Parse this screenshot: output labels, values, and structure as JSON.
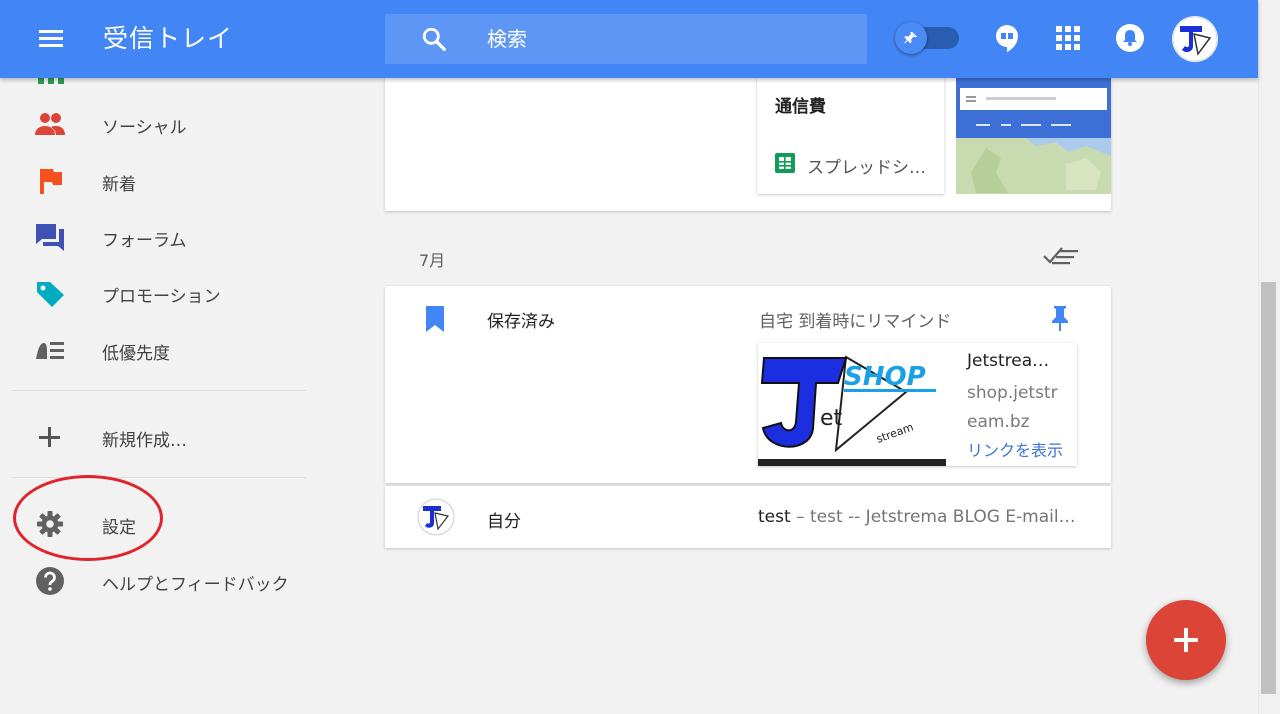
{
  "header": {
    "title": "受信トレイ",
    "search_placeholder": "検索",
    "icons": [
      "menu-icon",
      "search-icon",
      "pin-toggle-icon",
      "hangouts-icon",
      "apps-grid-icon",
      "notifications-bell-icon",
      "avatar"
    ]
  },
  "sidebar": {
    "items": [
      {
        "label": "ソーシャル",
        "icon": "people-icon"
      },
      {
        "label": "新着",
        "icon": "flag-icon"
      },
      {
        "label": "フォーラム",
        "icon": "forum-icon"
      },
      {
        "label": "プロモーション",
        "icon": "tag-icon"
      },
      {
        "label": "低優先度",
        "icon": "low-priority-icon"
      },
      {
        "label": "新規作成…",
        "icon": "plus-icon"
      },
      {
        "label": "設定",
        "icon": "gear-icon"
      },
      {
        "label": "ヘルプとフィードバック",
        "icon": "help-icon"
      }
    ]
  },
  "top_card": {
    "title": "通信費",
    "attachment_label": "スプレッドシ…"
  },
  "section": {
    "label": "7月"
  },
  "saved_card": {
    "title": "保存済み",
    "reminder": "自宅 到着時にリマインド",
    "link": {
      "title": "Jetstrea…",
      "url": "shop.jetstream.bz",
      "open_label": "リンクを表示",
      "image_logo_text": "SHOP"
    }
  },
  "self_card": {
    "sender": "自分",
    "subject": "test",
    "snippet": " – test -- Jetstrema BLOG E-mail…"
  },
  "colors": {
    "appbar": "#4285f4",
    "fab": "#db4437",
    "highlight_circle": "#e1232b"
  }
}
